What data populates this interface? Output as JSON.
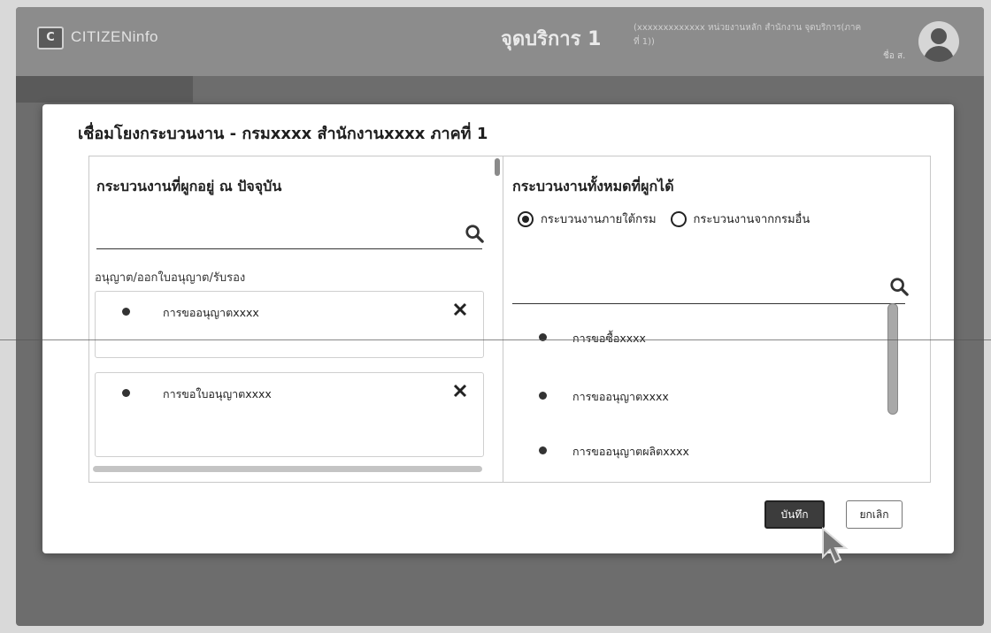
{
  "app": {
    "brand": "CITIZENinfo",
    "center_title": "จุดบริการ 1",
    "org_text": "(xxxxxxxxxxxxx หน่วยงานหลัก สำนักงาน จุดบริการ(ภาคที่ 1))",
    "user_short": "ชื่อ ส.",
    "logo_glyph": "C"
  },
  "modal": {
    "title": "เชื่อมโยงกระบวนงาน - กรมxxxx สำนักงานxxxx ภาคที่ 1",
    "left": {
      "title": "กระบวนงานที่ผูกอยู่ ณ ปัจจุบัน",
      "group_label": "อนุญาต/ออกใบอนุญาต/รับรอง",
      "items": [
        {
          "name": "การขออนุญาตxxxx"
        },
        {
          "name": "การขอใบอนุญาตxxxx"
        }
      ],
      "remove_glyph": "×"
    },
    "right": {
      "title": "กระบวนงานทั้งหมดที่ผูกได้",
      "radio_internal": "กระบวนงานภายใต้กรม",
      "radio_external": "กระบวนงานจากกรมอื่น",
      "selected": "internal",
      "items": [
        {
          "name": "การขอซื้อxxxx"
        },
        {
          "name": "การขออนุญาตxxxx"
        },
        {
          "name": "การขออนุญาตผลิตxxxx"
        }
      ]
    },
    "buttons": {
      "save": "บันทึก",
      "cancel": "ยกเลิก"
    }
  },
  "icons": [
    "search-icon",
    "close-icon",
    "avatar-icon",
    "cursor-icon"
  ],
  "colors": {
    "primary_button": "#3c3c3c",
    "backdrop": "#6d6d6d"
  }
}
